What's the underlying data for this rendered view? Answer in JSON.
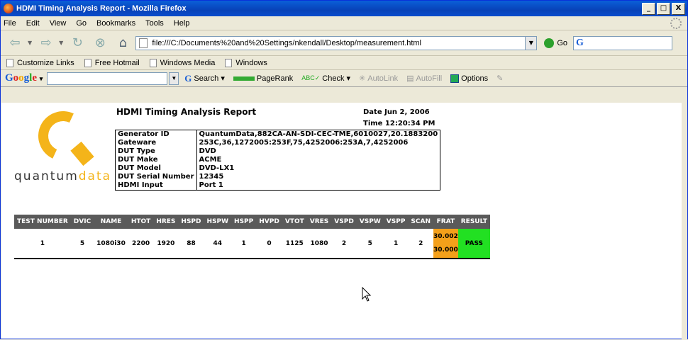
{
  "window": {
    "title": "HDMI Timing Analysis Report - Mozilla Firefox",
    "min": "_",
    "max": "□",
    "close": "X"
  },
  "menu": [
    "File",
    "Edit",
    "View",
    "Go",
    "Bookmarks",
    "Tools",
    "Help"
  ],
  "nav": {
    "url": "file:///C:/Documents%20and%20Settings/nkendall/Desktop/measurement.html",
    "go_label": "Go",
    "search_logo": "G"
  },
  "links": [
    "Customize Links",
    "Free Hotmail",
    "Windows Media",
    "Windows"
  ],
  "google_bar": {
    "search_label": "Search",
    "pagerank": "PageRank",
    "check": "Check",
    "autolink": "AutoLink",
    "autofill": "AutoFill",
    "options": "Options"
  },
  "report": {
    "title": "HDMI Timing Analysis Report",
    "date": "Date Jun 2, 2006",
    "time": "Time 12:20:34 PM",
    "logo": {
      "main": "quantum",
      "accent": "data"
    },
    "info": [
      {
        "k": "Generator ID",
        "v": "QuantumData,882CA-AN-SDI-CEC-TME,6010027,20.1883200"
      },
      {
        "k": "Gateware",
        "v": "253C,36,1272005:253F,75,4252006:253A,7,4252006"
      },
      {
        "k": "DUT Type",
        "v": "DVD"
      },
      {
        "k": "DUT Make",
        "v": "ACME"
      },
      {
        "k": "DUT Model",
        "v": "DVD-LX1"
      },
      {
        "k": "DUT Serial Number",
        "v": "12345"
      },
      {
        "k": "HDMI Input",
        "v": "Port 1"
      }
    ],
    "columns": [
      "TEST NUMBER",
      "DVIC",
      "NAME",
      "HTOT",
      "HRES",
      "HSPD",
      "HSPW",
      "HSPP",
      "HVPD",
      "VTOT",
      "VRES",
      "VSPD",
      "VSPW",
      "VSPP",
      "SCAN",
      "FRAT",
      "RESULT"
    ],
    "row": {
      "test": "1",
      "dvic": "5",
      "name": "1080i30",
      "htot": "2200",
      "hres": "1920",
      "hspd": "88",
      "hspw": "44",
      "hspp": "1",
      "hvpd": "0",
      "vtot": "1125",
      "vres": "1080",
      "vspd": "2",
      "vspw": "5",
      "vspp": "1",
      "scan": "2",
      "frat1": "30.002",
      "frat2": "30.000",
      "result": "PASS"
    },
    "colors": {
      "frat": "#f4a01a",
      "pass": "#22e022",
      "header": "#5a5a5a",
      "logo": "#f4b41a"
    }
  }
}
